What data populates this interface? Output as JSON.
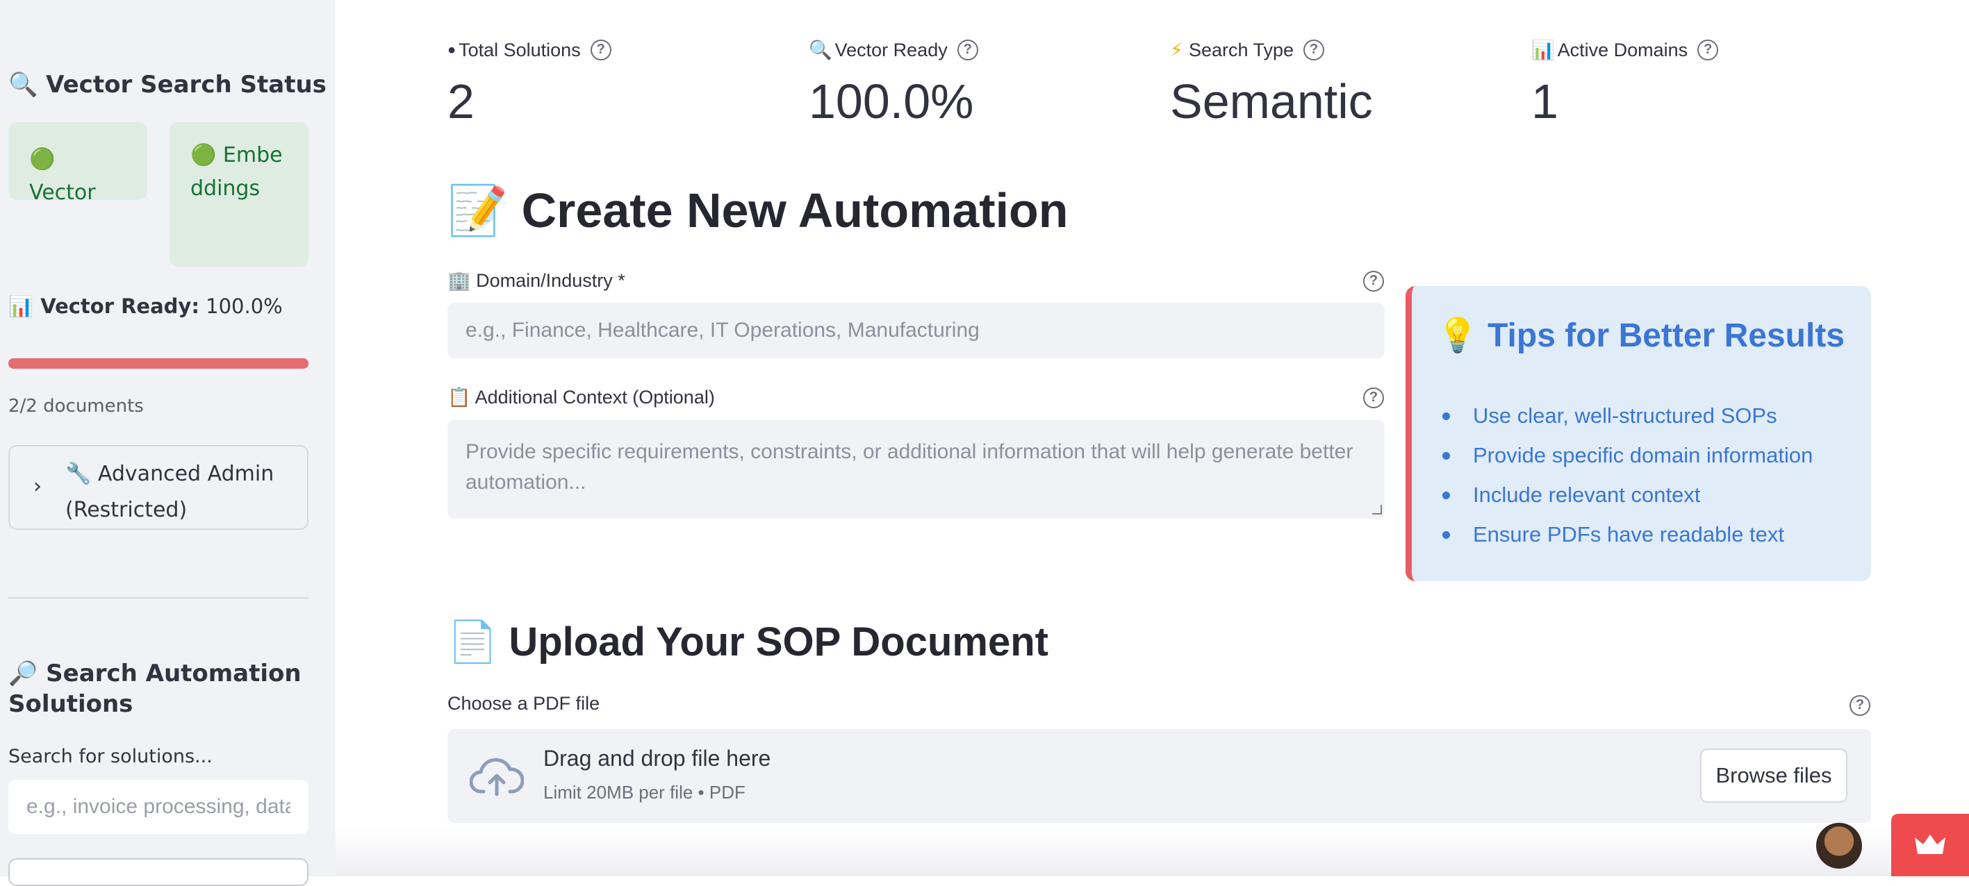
{
  "sidebar": {
    "vector_status_title": "🔍 Vector Search Status",
    "pill_vector": "🟢 Vector",
    "pill_embeddings": "🟢 Embeddings",
    "vector_ready_label": "📊 Vector Ready:",
    "vector_ready_value": "100.0%",
    "progress_fraction": 1.0,
    "documents_count": "2/2 documents",
    "advanced_admin": "🔧 Advanced Admin (Restricted)",
    "search_title": "🔎 Search Automation Solutions",
    "search_label": "Search for solutions...",
    "search_placeholder": "e.g., invoice processing, data"
  },
  "metrics": [
    {
      "label": "Total Solutions",
      "icon": "●",
      "value": "2"
    },
    {
      "label": "Vector Ready",
      "icon": "🔍",
      "value": "100.0%"
    },
    {
      "label": "Search Type",
      "icon": "⚡",
      "value": "Semantic"
    },
    {
      "label": "Active Domains",
      "icon": "📊",
      "value": "1"
    }
  ],
  "create": {
    "title": "📝 Create New Automation",
    "domain_label": "Domain/Industry *",
    "domain_icon": "🏢",
    "domain_placeholder": "e.g., Finance, Healthcare, IT Operations, Manufacturing",
    "context_label": "Additional Context (Optional)",
    "context_icon": "📋",
    "context_placeholder": "Provide specific requirements, constraints, or additional information that will help generate better automation..."
  },
  "tips": {
    "title": "💡 Tips for Better Results",
    "items": [
      "Use clear, well-structured SOPs",
      "Provide specific domain information",
      "Include relevant context",
      "Ensure PDFs have readable text"
    ]
  },
  "upload": {
    "title": "📄 Upload Your SOP Document",
    "file_label": "Choose a PDF file",
    "drop_title": "Drag and drop file here",
    "drop_sub": "Limit 20MB per file • PDF",
    "browse_label": "Browse files"
  },
  "colors": {
    "accent_red": "#e56c6f",
    "tips_blue": "#3b76d4",
    "success_green": "#177233"
  }
}
